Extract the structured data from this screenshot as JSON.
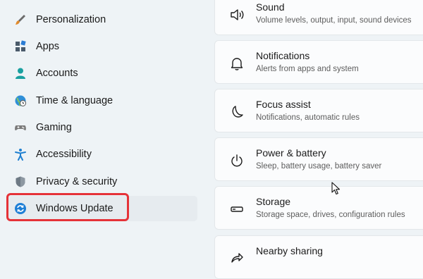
{
  "sidebar": {
    "items": [
      {
        "label": "Personalization",
        "icon": "brush-icon"
      },
      {
        "label": "Apps",
        "icon": "apps-icon"
      },
      {
        "label": "Accounts",
        "icon": "person-icon"
      },
      {
        "label": "Time & language",
        "icon": "globe-clock-icon"
      },
      {
        "label": "Gaming",
        "icon": "gamepad-icon"
      },
      {
        "label": "Accessibility",
        "icon": "accessibility-icon"
      },
      {
        "label": "Privacy & security",
        "icon": "shield-icon"
      },
      {
        "label": "Windows Update",
        "icon": "sync-icon",
        "active": true
      }
    ]
  },
  "main": {
    "cards": [
      {
        "title": "Sound",
        "subtitle": "Volume levels, output, input, sound devices",
        "icon": "speaker-icon"
      },
      {
        "title": "Notifications",
        "subtitle": "Alerts from apps and system",
        "icon": "bell-icon"
      },
      {
        "title": "Focus assist",
        "subtitle": "Notifications, automatic rules",
        "icon": "moon-icon"
      },
      {
        "title": "Power & battery",
        "subtitle": "Sleep, battery usage, battery saver",
        "icon": "power-icon"
      },
      {
        "title": "Storage",
        "subtitle": "Storage space, drives, configuration rules",
        "icon": "storage-icon"
      },
      {
        "title": "Nearby sharing",
        "subtitle": "",
        "icon": "share-icon"
      }
    ]
  },
  "colors": {
    "highlight": "#e53238",
    "accent": "#0067c0"
  }
}
